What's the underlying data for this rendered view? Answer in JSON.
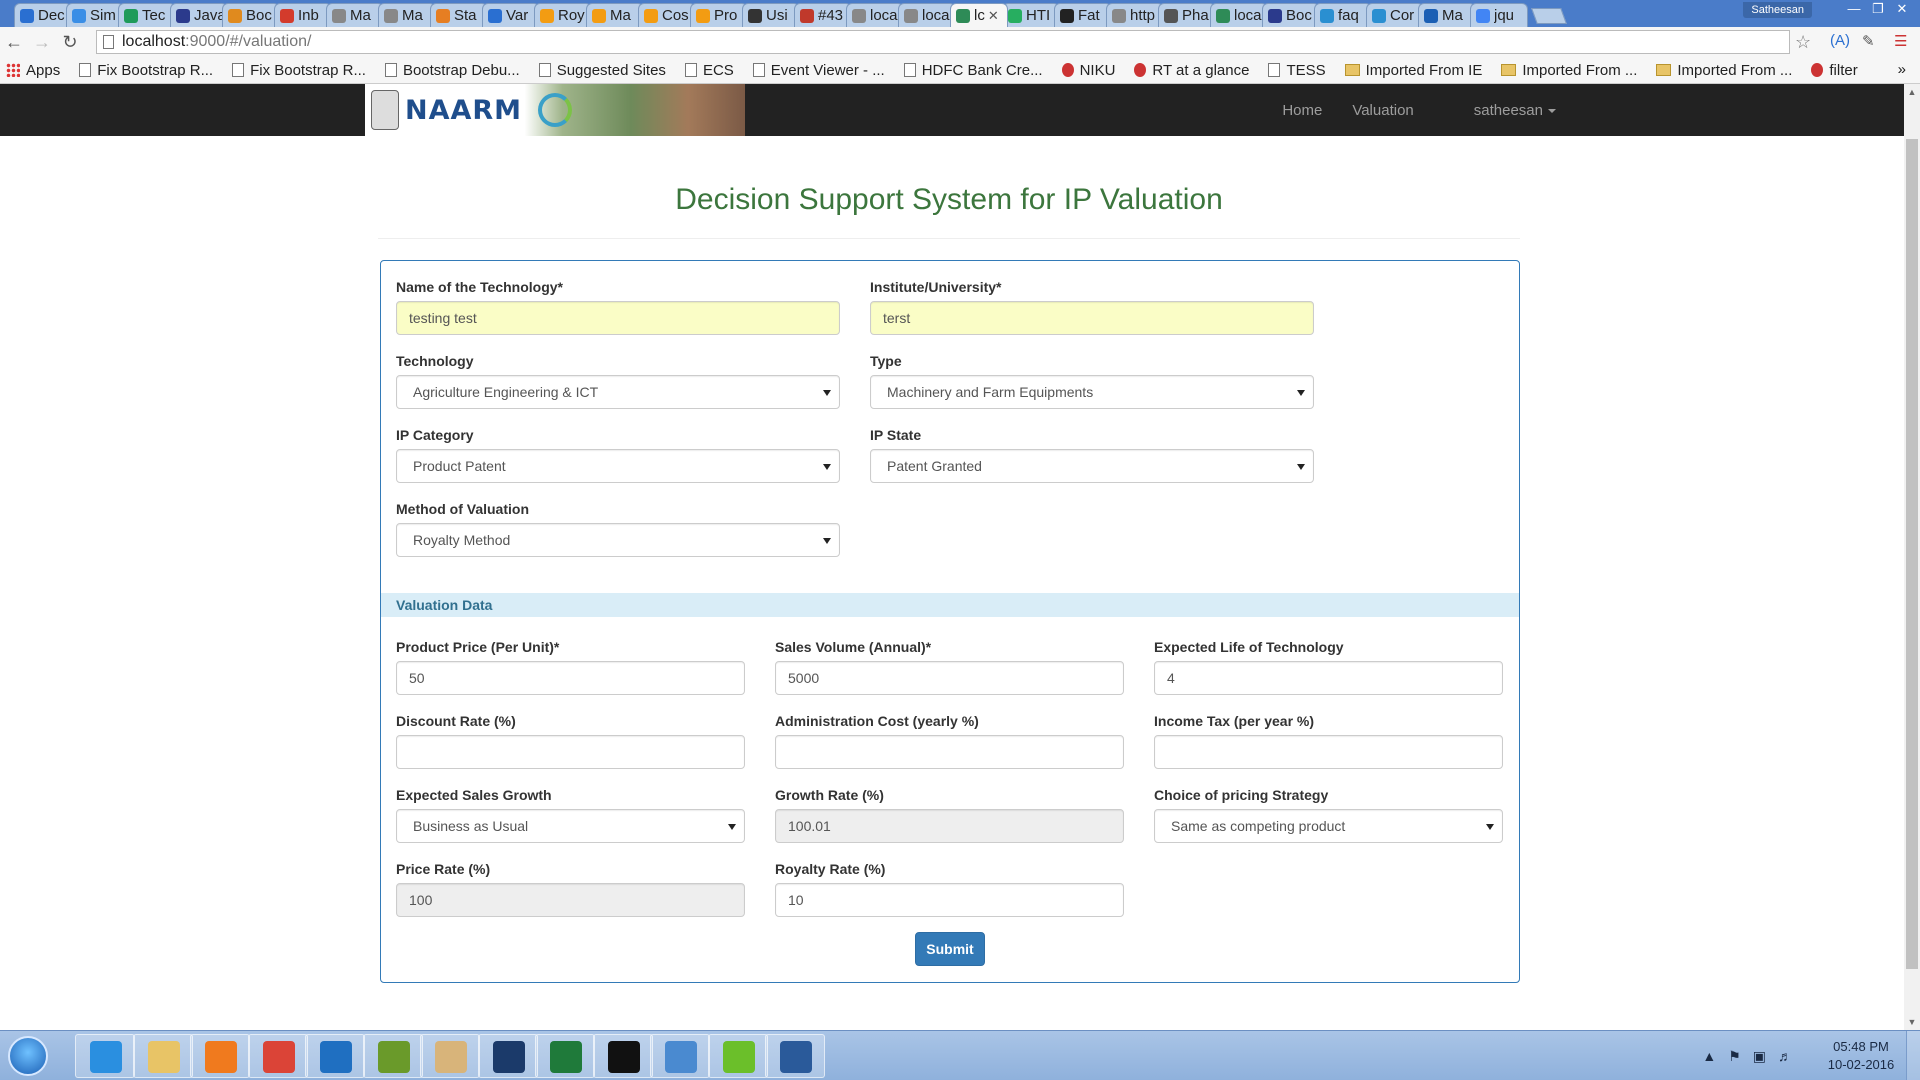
{
  "browser": {
    "tabs": [
      {
        "label": "Dec",
        "color": "#2a6fd1"
      },
      {
        "label": "Sim",
        "color": "#3a8ee6"
      },
      {
        "label": "Tec",
        "color": "#1f9b5a"
      },
      {
        "label": "Java",
        "color": "#2b3a8c"
      },
      {
        "label": "Boc",
        "color": "#e08a1e"
      },
      {
        "label": "Inb",
        "color": "#d33b2c"
      },
      {
        "label": "Ma",
        "color": "#888888"
      },
      {
        "label": "Ma",
        "color": "#888888"
      },
      {
        "label": "Sta",
        "color": "#e67e22"
      },
      {
        "label": "Var",
        "color": "#2a6fd1"
      },
      {
        "label": "Roy",
        "color": "#f39c12"
      },
      {
        "label": "Ma",
        "color": "#f39c12"
      },
      {
        "label": "Cos",
        "color": "#f39c12"
      },
      {
        "label": "Pro",
        "color": "#f39c12"
      },
      {
        "label": "Usi",
        "color": "#333333"
      },
      {
        "label": "#43",
        "color": "#c0392b"
      },
      {
        "label": "loca",
        "color": "#888888"
      },
      {
        "label": "loca",
        "color": "#888888"
      },
      {
        "label": "lc",
        "color": "#2e8b57",
        "active": true
      },
      {
        "label": "HTI",
        "color": "#27ae60"
      },
      {
        "label": "Fat",
        "color": "#222222"
      },
      {
        "label": "http",
        "color": "#888888"
      },
      {
        "label": "Pha",
        "color": "#555555"
      },
      {
        "label": "loca",
        "color": "#2e8b57"
      },
      {
        "label": "Boc",
        "color": "#2b3a8c"
      },
      {
        "label": "faq",
        "color": "#2a8fd1"
      },
      {
        "label": "Cor",
        "color": "#2a8fd1"
      },
      {
        "label": "Ma",
        "color": "#1b5fb4"
      },
      {
        "label": "jqu",
        "color": "#4285f4"
      }
    ],
    "user": "Satheesan",
    "url_host": "localhost",
    "url_path": ":9000/#/valuation/",
    "bookmarks": [
      {
        "label": "Apps",
        "icon": "apps-icon"
      },
      {
        "label": "Fix Bootstrap R...",
        "icon": "page-icon"
      },
      {
        "label": "Fix Bootstrap R...",
        "icon": "page-icon"
      },
      {
        "label": "Bootstrap Debu...",
        "icon": "page-icon"
      },
      {
        "label": "Suggested Sites",
        "icon": "page-icon"
      },
      {
        "label": "ECS",
        "icon": "page-icon"
      },
      {
        "label": "Event Viewer - ...",
        "icon": "page-icon"
      },
      {
        "label": "HDFC Bank Cre...",
        "icon": "page-icon"
      },
      {
        "label": "NIKU",
        "icon": "ca-icon"
      },
      {
        "label": "RT at a glance",
        "icon": "rt-icon"
      },
      {
        "label": "TESS",
        "icon": "page-icon"
      },
      {
        "label": "Imported From IE",
        "icon": "folder-icon"
      },
      {
        "label": "Imported From ...",
        "icon": "folder-icon"
      },
      {
        "label": "Imported From ...",
        "icon": "folder-icon"
      },
      {
        "label": "filter",
        "icon": "angular-icon"
      }
    ]
  },
  "navbar": {
    "brand": "NAARM",
    "links": [
      "Home",
      "Valuation"
    ],
    "user_menu": "satheesan"
  },
  "page": {
    "title": "Decision Support System for IP Valuation",
    "form": {
      "technology_name": {
        "label": "Name of the Technology*",
        "value": "testing test"
      },
      "institute": {
        "label": "Institute/University*",
        "value": "terst"
      },
      "technology": {
        "label": "Technology",
        "value": "Agriculture Engineering & ICT"
      },
      "type": {
        "label": "Type",
        "value": "Machinery and Farm Equipments"
      },
      "ip_category": {
        "label": "IP Category",
        "value": "Product Patent"
      },
      "ip_state": {
        "label": "IP State",
        "value": "Patent Granted"
      },
      "method": {
        "label": "Method of Valuation",
        "value": "Royalty Method"
      }
    },
    "valuation_section": "Valuation Data",
    "valuation": {
      "product_price": {
        "label": "Product Price (Per Unit)*",
        "value": "50"
      },
      "sales_volume": {
        "label": "Sales Volume (Annual)*",
        "value": "5000"
      },
      "expected_life": {
        "label": "Expected Life of Technology",
        "value": "4"
      },
      "discount_rate": {
        "label": "Discount Rate (%)",
        "value": ""
      },
      "admin_cost": {
        "label": "Administration Cost (yearly %)",
        "value": ""
      },
      "income_tax": {
        "label": "Income Tax (per year %)",
        "value": ""
      },
      "sales_growth": {
        "label": "Expected Sales Growth",
        "value": "Business as Usual"
      },
      "growth_rate": {
        "label": "Growth Rate (%)",
        "value": "100.01"
      },
      "pricing_strategy": {
        "label": "Choice of pricing Strategy",
        "value": "Same as competing product"
      },
      "price_rate": {
        "label": "Price Rate (%)",
        "value": "100"
      },
      "royalty_rate": {
        "label": "Royalty Rate (%)",
        "value": "10"
      }
    },
    "submit_label": "Submit"
  },
  "taskbar": {
    "items": [
      {
        "name": "internet-explorer-icon",
        "color": "#2a8fe0"
      },
      {
        "name": "file-explorer-icon",
        "color": "#e8c466"
      },
      {
        "name": "media-player-icon",
        "color": "#f07a1e"
      },
      {
        "name": "chrome-icon",
        "color": "#db4437"
      },
      {
        "name": "outlook-icon",
        "color": "#1f6fc1"
      },
      {
        "name": "lambda-app-icon",
        "color": "#6a9a2a"
      },
      {
        "name": "paint-icon",
        "color": "#d8b47a"
      },
      {
        "name": "window-app-icon",
        "color": "#1b3a6a"
      },
      {
        "name": "excel-icon",
        "color": "#1f7a3a"
      },
      {
        "name": "command-prompt-icon",
        "color": "#111111"
      },
      {
        "name": "remote-desktop-icon",
        "color": "#4a8ad0"
      },
      {
        "name": "peas-app-icon",
        "color": "#6bbf2a"
      },
      {
        "name": "brackets-icon",
        "color": "#2a5a9a"
      }
    ],
    "time": "05:48 PM",
    "date": "10-02-2016"
  }
}
